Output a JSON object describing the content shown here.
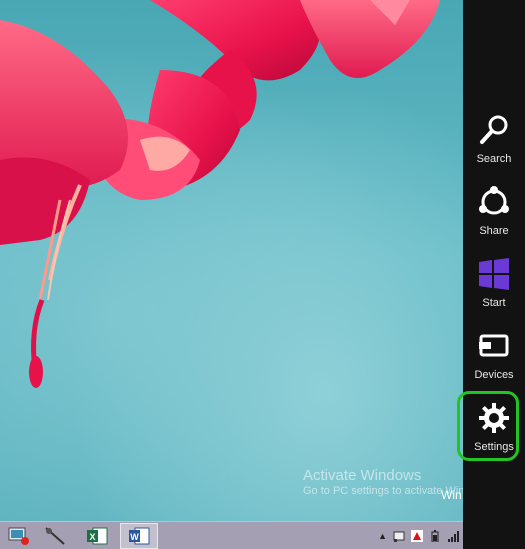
{
  "desktop": {
    "watermark_title": "Activate Windows",
    "watermark_sub": "Go to PC settings to activate Windows.",
    "clock_fragment": "Win"
  },
  "charms": {
    "items": [
      {
        "label": "Search",
        "icon": "magnifier-icon"
      },
      {
        "label": "Share",
        "icon": "share-icon"
      },
      {
        "label": "Start",
        "icon": "windows-logo-icon"
      },
      {
        "label": "Devices",
        "icon": "devices-icon"
      },
      {
        "label": "Settings",
        "icon": "gear-icon"
      }
    ],
    "highlight_color": "#22c422",
    "background": "#121212"
  },
  "taskbar": {
    "apps": [
      {
        "name": "remote-desktop-app",
        "icon": "monitor-icon"
      },
      {
        "name": "pen-tool-app",
        "icon": "pen-icon"
      },
      {
        "name": "excel-app",
        "icon": "excel-icon"
      },
      {
        "name": "word-app",
        "icon": "word-icon",
        "active": true
      }
    ],
    "tray": {
      "show_hidden_glyph": "▲",
      "icons": [
        "action-center-icon",
        "antivirus-icon",
        "battery-icon",
        "network-icon"
      ]
    },
    "background": "#a49fb3"
  }
}
